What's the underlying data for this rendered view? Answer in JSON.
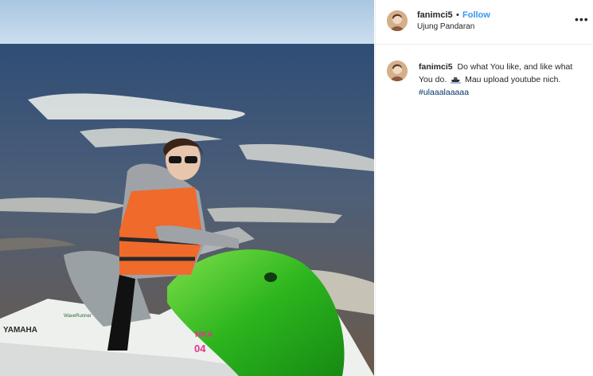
{
  "post": {
    "username": "fanimci5",
    "dot": "•",
    "follow_label": "Follow",
    "location": "Ujung Pandaran",
    "more_icon": "more-horizontal-icon",
    "caption": {
      "username": "fanimci5",
      "text_before": "Do what You like, and like what You do.",
      "emoji": "speedboat-emoji",
      "text_after": "Mau upload youtube nich.",
      "hashtag": "#ulaaalaaaaa"
    }
  },
  "photo": {
    "jetski_brand": "YAMAHA",
    "jetski_model": "WaveRunner",
    "number_top": "MKA",
    "number_bottom": "04"
  },
  "colors": {
    "link_blue": "#3897f0",
    "hashtag_blue": "#003569",
    "text_dark": "#262626",
    "border": "#efefef"
  }
}
